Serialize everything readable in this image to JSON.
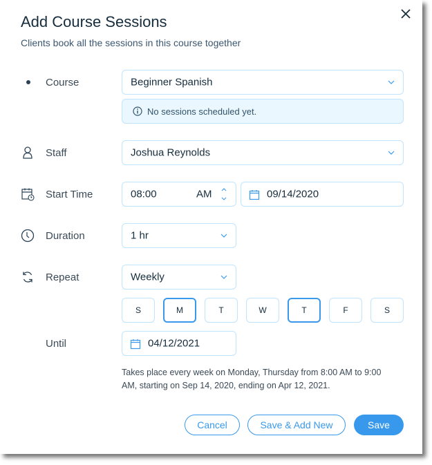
{
  "dialog": {
    "title": "Add Course Sessions",
    "subtitle": "Clients book all the sessions in this course together",
    "close_icon": "close-icon"
  },
  "course": {
    "label": "Course",
    "value": "Beginner Spanish",
    "info_icon": "info-icon",
    "info_text": "No sessions scheduled yet."
  },
  "staff": {
    "label": "Staff",
    "icon": "person-icon",
    "value": "Joshua Reynolds"
  },
  "start_time": {
    "label": "Start Time",
    "icon": "calendar-clock-icon",
    "time": "08:00",
    "ampm": "AM",
    "date": "09/14/2020"
  },
  "duration": {
    "label": "Duration",
    "icon": "clock-icon",
    "value": "1 hr"
  },
  "repeat": {
    "label": "Repeat",
    "icon": "repeat-icon",
    "value": "Weekly",
    "days": [
      {
        "label": "S",
        "selected": false
      },
      {
        "label": "M",
        "selected": true
      },
      {
        "label": "T",
        "selected": false
      },
      {
        "label": "W",
        "selected": false
      },
      {
        "label": "T",
        "selected": true
      },
      {
        "label": "F",
        "selected": false
      },
      {
        "label": "S",
        "selected": false
      }
    ]
  },
  "until": {
    "label": "Until",
    "date": "04/12/2021"
  },
  "summary": "Takes place every week on Monday, Thursday from 8:00 AM to 9:00 AM, starting on Sep 14, 2020, ending on Apr 12, 2021.",
  "buttons": {
    "cancel": "Cancel",
    "save_add_new": "Save & Add New",
    "save": "Save"
  },
  "colors": {
    "accent": "#3899ec",
    "border": "#c1e4fe",
    "info_bg": "#eaf7ff",
    "text": "#162d3d"
  }
}
